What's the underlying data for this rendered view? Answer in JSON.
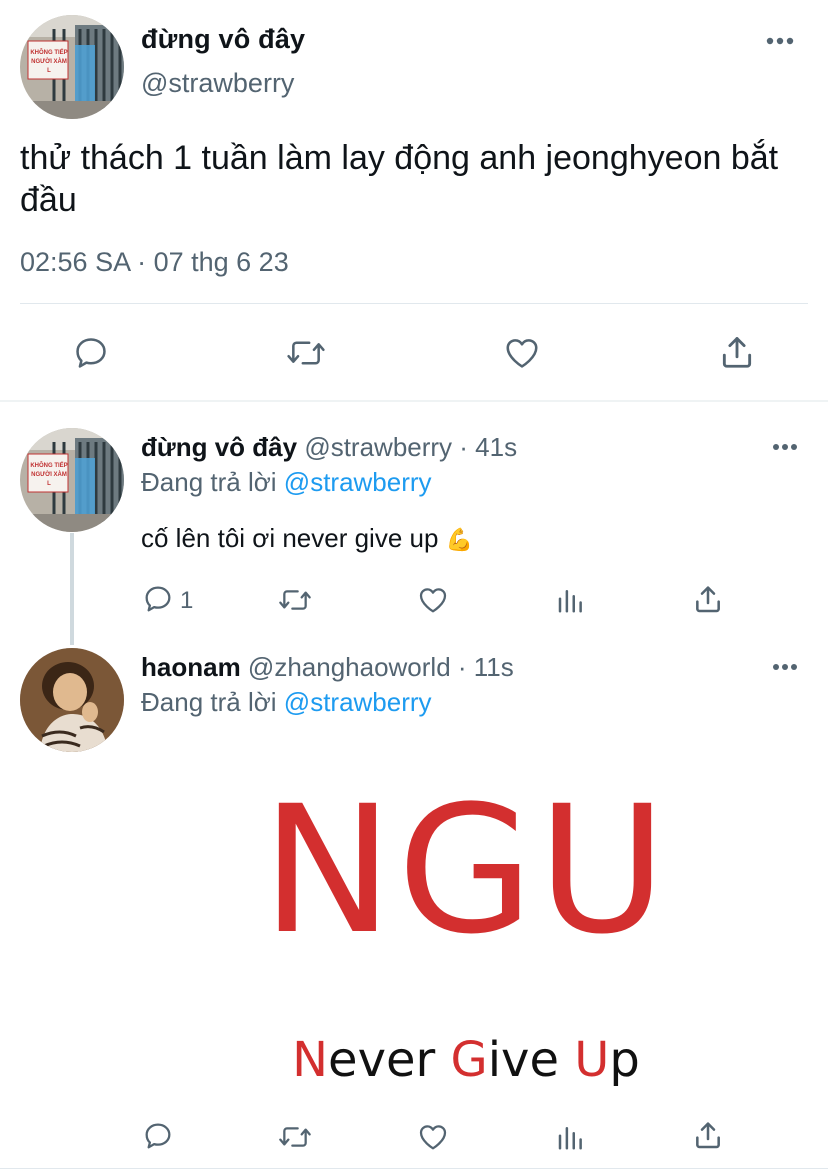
{
  "main_tweet": {
    "display_name": "đừng vô đây",
    "handle": "@strawberry",
    "text": "thử thách 1 tuần làm lay động anh jeonghyeon bắt đầu",
    "timestamp": "02:56 SA · 07 thg 6 23",
    "avatar_sign_line1": "KHÔNG TIẾP",
    "avatar_sign_line2": "NGƯỜI XÀM L"
  },
  "reply_1": {
    "display_name": "đừng vô đây",
    "handle_time": "@strawberry · 41s",
    "replying_prefix": "Đang trả lời",
    "replying_to": "@strawberry",
    "text": "cố lên tôi ơi never give up",
    "emoji": "💪",
    "reply_count": "1",
    "avatar_sign_line1": "KHÔNG TIẾP",
    "avatar_sign_line2": "NGƯỜI XÀM L"
  },
  "reply_2": {
    "display_name": "haonam",
    "handle_time": "@zhanghaoworld · 11s",
    "replying_prefix": "Đang trả lời",
    "replying_to": "@strawberry",
    "image": {
      "big_text": "NGU",
      "small_parts": [
        "N",
        "ever ",
        "G",
        "ive ",
        "U",
        "p"
      ]
    }
  },
  "icons": {
    "reply": "reply-icon",
    "retweet": "retweet-icon",
    "like": "heart-icon",
    "share": "share-icon",
    "views": "analytics-icon",
    "more": "more-icon"
  },
  "colors": {
    "link": "#1d9bf0",
    "secondary_text": "#536471",
    "image_red": "#d32f2f"
  }
}
